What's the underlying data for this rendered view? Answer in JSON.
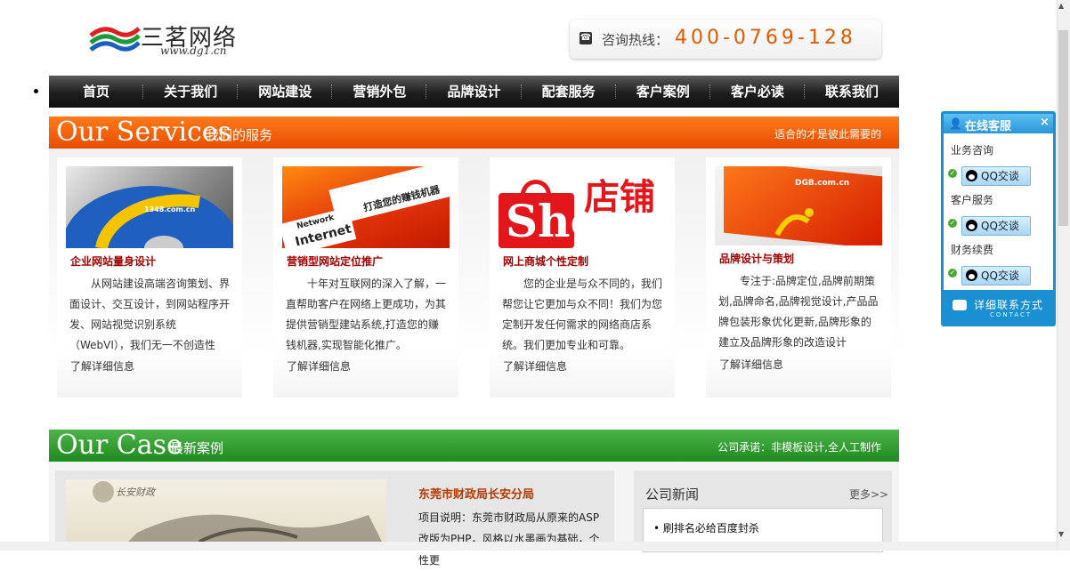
{
  "header": {
    "logo_text": "三茗网络",
    "logo_url": "www.dg1.cn",
    "hotline_label": "咨询热线：",
    "hotline_number": "400-0769-128"
  },
  "nav": {
    "items": [
      "首页",
      "关于我们",
      "网站建设",
      "营销外包",
      "品牌设计",
      "配套服务",
      "客户案例",
      "客户必读",
      "联系我们"
    ]
  },
  "services": {
    "title_en": "Our Services",
    "title_cn": "我们的服务",
    "slogan": "适合的才是彼此需要的",
    "cards": [
      {
        "img_text": "1348.com.cn",
        "title": "企业网站量身设计",
        "desc": "从网站建设高端咨询策划、界面设计、交互设计，到网站程序开发、网站视觉识别系统（WebVI），我们无一不创造性",
        "more": "了解详细信息"
      },
      {
        "img_text": "打造您的赚钱机器",
        "img_text2": "Network",
        "img_text3": "Internet",
        "title": "营销型网站定位推广",
        "desc": "十年对互联网的深入了解，一直帮助客户在网络上更成功，为其提供营销型建站系统,打造您的赚钱机器,实现智能化推广。",
        "more": "了解详细信息"
      },
      {
        "img_text": "店铺",
        "img_text2": "Shop",
        "title": "网上商城个性定制",
        "desc": "您的企业是与众不同的，我们帮您让它更加与众不同！我们为您定制开发任何需求的网络商店系统。我们更加专业和可靠。",
        "more": "了解详细信息"
      },
      {
        "img_text": "DGB.com.cn",
        "title": "品牌设计与策划",
        "desc": "专注于:品牌定位,品牌前期策划,品牌命名,品牌视觉设计,产品品牌包装形象优化更新,品牌形象的建立及品牌形象的改造设计",
        "more": "了解详细信息"
      }
    ]
  },
  "case": {
    "title_en": "Our Case",
    "title_cn": "最新案例",
    "slogan": "公司承诺：非模板设计,全人工制作",
    "img_text": "长安财政",
    "item_title": "东莞市财政局长安分局",
    "item_desc": "项目说明：东莞市财政局从原来的ASP改版为PHP，风格以水墨画为基础，个性更"
  },
  "news": {
    "title": "公司新闻",
    "more": "更多>>",
    "items": [
      "刷排名必给百度封杀"
    ]
  },
  "online_service": {
    "title": "在线客服",
    "close": "×",
    "groups": [
      {
        "label": "业务咨询",
        "button": "QQ交谈"
      },
      {
        "label": "客户服务",
        "button": "QQ交谈"
      },
      {
        "label": "财务续费",
        "button": "QQ交谈"
      }
    ],
    "footer": "详细联系方式",
    "footer_sub": "CONTACT"
  },
  "colors": {
    "orange": "#e84d00",
    "green": "#1f8a1f",
    "nav_dark": "#1e1e1e",
    "card_title": "#a30000",
    "cs_blue": "#1a8fd2"
  }
}
